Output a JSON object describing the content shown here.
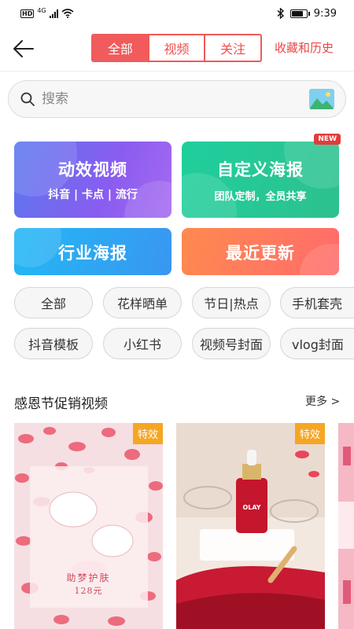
{
  "status_bar": {
    "network": "HD",
    "network_type": "4G",
    "time": "9:39",
    "battery_level": 0.85
  },
  "header": {
    "tabs": [
      {
        "label": "全部",
        "active": true
      },
      {
        "label": "视频",
        "active": false
      },
      {
        "label": "关注",
        "active": false
      }
    ],
    "favorites_link": "收藏和历史"
  },
  "search": {
    "placeholder": "搜索",
    "value": ""
  },
  "feature_cards": {
    "motion_video": {
      "title": "动效视频",
      "subtitle": "抖音 | 卡点 | 流行"
    },
    "custom_poster": {
      "title": "自定义海报",
      "subtitle": "团队定制，全员共享",
      "badge": "NEW"
    },
    "industry_poster": {
      "title": "行业海报"
    },
    "recent_updates": {
      "title": "最近更新"
    }
  },
  "categories": [
    "全部",
    "花样晒单",
    "节日|热点",
    "手机套壳",
    "抖音模板",
    "小红书",
    "视频号封面",
    "vlog封面"
  ],
  "section": {
    "title": "感恩节促销视频",
    "more": "更多 >"
  },
  "thumbnails": [
    {
      "tag": "特效",
      "caption": "助梦护肤",
      "price": "128元"
    },
    {
      "tag": "特效",
      "brand": "OLAY"
    }
  ],
  "colors": {
    "accent": "#f15b5b",
    "tag": "#f5a623"
  }
}
